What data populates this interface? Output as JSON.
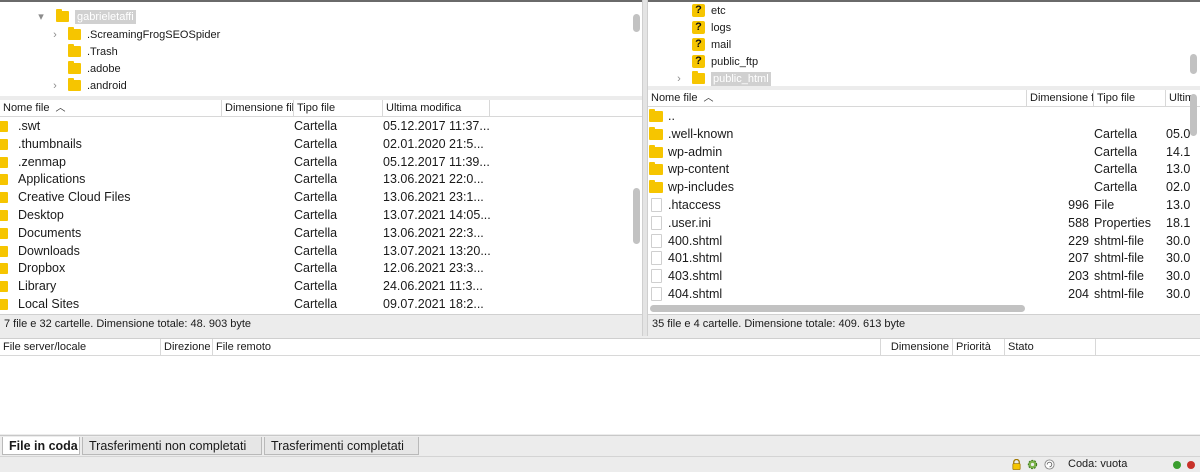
{
  "local_tree": {
    "items": [
      {
        "label": "gabrieletaffi",
        "expander": "▾",
        "selected": true
      },
      {
        "label": ".ScreamingFrogSEOSpider",
        "expander": "›"
      },
      {
        "label": ".Trash",
        "expander": ""
      },
      {
        "label": ".adobe",
        "expander": ""
      },
      {
        "label": ".android",
        "expander": "›"
      }
    ]
  },
  "remote_tree": {
    "items": [
      {
        "label": "etc",
        "icon": "?",
        "expander": ""
      },
      {
        "label": "logs",
        "icon": "?",
        "expander": ""
      },
      {
        "label": "mail",
        "icon": "?",
        "expander": ""
      },
      {
        "label": "public_ftp",
        "icon": "?",
        "expander": ""
      },
      {
        "label": "public_html",
        "icon": "folder",
        "expander": "›",
        "selected": true
      }
    ]
  },
  "local_list": {
    "headers": {
      "name": "Nome file",
      "size": "Dimensione file",
      "type": "Tipo file",
      "modified": "Ultima modifica"
    },
    "rows": [
      {
        "name": ".swt",
        "type": "Cartella",
        "modified": "05.12.2017 11:37..."
      },
      {
        "name": ".thumbnails",
        "type": "Cartella",
        "modified": "02.01.2020 21:5..."
      },
      {
        "name": ".zenmap",
        "type": "Cartella",
        "modified": "05.12.2017 11:39..."
      },
      {
        "name": "Applications",
        "type": "Cartella",
        "modified": "13.06.2021 22:0..."
      },
      {
        "name": "Creative Cloud Files",
        "type": "Cartella",
        "modified": "13.06.2021 23:1..."
      },
      {
        "name": "Desktop",
        "type": "Cartella",
        "modified": "13.07.2021 14:05..."
      },
      {
        "name": "Documents",
        "type": "Cartella",
        "modified": "13.06.2021 22:3..."
      },
      {
        "name": "Downloads",
        "type": "Cartella",
        "modified": "13.07.2021 13:20..."
      },
      {
        "name": "Dropbox",
        "type": "Cartella",
        "modified": "12.06.2021 23:3..."
      },
      {
        "name": "Library",
        "type": "Cartella",
        "modified": "24.06.2021 11:3..."
      },
      {
        "name": "Local Sites",
        "type": "Cartella",
        "modified": "09.07.2021 18:2..."
      }
    ],
    "status": "7 file e 32 cartelle. Dimensione totale: 48. 903 byte"
  },
  "remote_list": {
    "headers": {
      "name": "Nome file",
      "size": "Dimensione fi",
      "type": "Tipo file",
      "modified": "Ultim"
    },
    "rows": [
      {
        "name": "..",
        "size": "",
        "type": "",
        "modified": "",
        "icon": "folder"
      },
      {
        "name": ".well-known",
        "size": "",
        "type": "Cartella",
        "modified": "05.0",
        "icon": "folder"
      },
      {
        "name": "wp-admin",
        "size": "",
        "type": "Cartella",
        "modified": "14.1",
        "icon": "folder"
      },
      {
        "name": "wp-content",
        "size": "",
        "type": "Cartella",
        "modified": "13.0",
        "icon": "folder"
      },
      {
        "name": "wp-includes",
        "size": "",
        "type": "Cartella",
        "modified": "02.0",
        "icon": "folder"
      },
      {
        "name": ".htaccess",
        "size": "996",
        "type": "File",
        "modified": "13.0",
        "icon": "file"
      },
      {
        "name": ".user.ini",
        "size": "588",
        "type": "Properties",
        "modified": "18.1",
        "icon": "file"
      },
      {
        "name": "400.shtml",
        "size": "229",
        "type": "shtml-file",
        "modified": "30.0",
        "icon": "file"
      },
      {
        "name": "401.shtml",
        "size": "207",
        "type": "shtml-file",
        "modified": "30.0",
        "icon": "file"
      },
      {
        "name": "403.shtml",
        "size": "203",
        "type": "shtml-file",
        "modified": "30.0",
        "icon": "file"
      },
      {
        "name": "404.shtml",
        "size": "204",
        "type": "shtml-file",
        "modified": "30.0",
        "icon": "file"
      }
    ],
    "status": "35 file e 4 cartelle. Dimensione totale: 409. 613 byte"
  },
  "queue": {
    "headers": {
      "server_local": "File server/locale",
      "direction": "Direzione",
      "remote": "File remoto",
      "size": "Dimensione",
      "priority": "Priorità",
      "status": "Stato"
    }
  },
  "tabs": [
    "File in coda",
    "Trasferimenti non completati",
    "Trasferimenti completati"
  ],
  "footer": {
    "queue_status": "Coda: vuota"
  },
  "colors": {
    "folder": "#f6c500",
    "led_green": "#3a9e2e",
    "led_red": "#c8322a"
  }
}
